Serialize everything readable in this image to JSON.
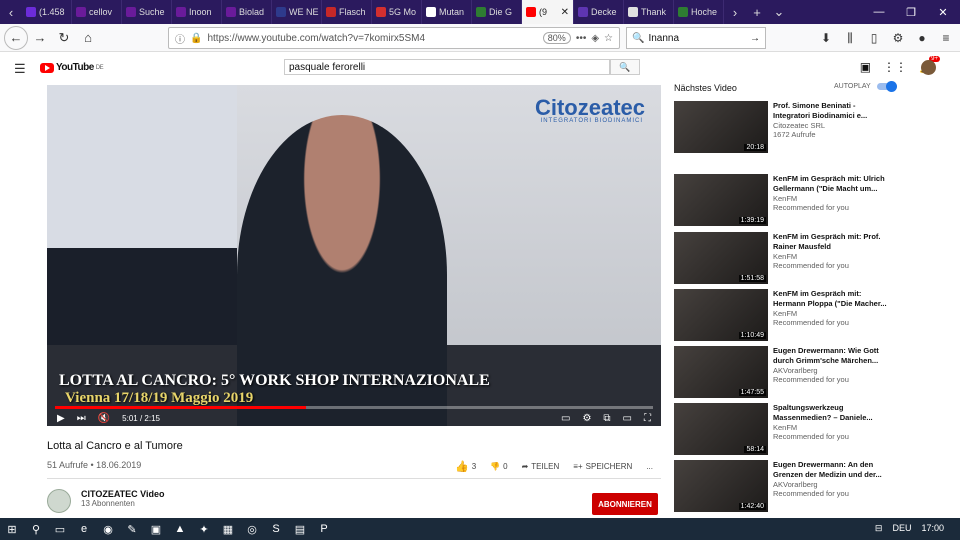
{
  "browser": {
    "tabs": [
      {
        "label": "(1.458",
        "color": "#6c2cd9"
      },
      {
        "label": "cellov",
        "color": "#6a1b9a"
      },
      {
        "label": "Suche",
        "color": "#6a1b9a"
      },
      {
        "label": "Inoon",
        "color": "#6a1b9a"
      },
      {
        "label": "Biolad",
        "color": "#6a1b9a"
      },
      {
        "label": "WE NE GE",
        "color": "#2e3a8c"
      },
      {
        "label": "Flasch",
        "color": "#c62828"
      },
      {
        "label": "5G Mo",
        "color": "#d32f2f"
      },
      {
        "label": "Mutan",
        "color": "#ffffff"
      },
      {
        "label": "Die G",
        "color": "#2e7d32"
      },
      {
        "label": "(9",
        "color": "#ff0000"
      },
      {
        "label": "Decke",
        "color": "#5e35b1"
      },
      {
        "label": "Thank",
        "color": "#e0e0e0"
      },
      {
        "label": "Hoche",
        "color": "#2e7d32"
      }
    ],
    "active_tab_index": 10,
    "url": "https://www.youtube.com/watch?v=7komirx5SM4",
    "zoom": "80%",
    "search_value": "Inanna"
  },
  "youtube": {
    "logo_text": "YouTube",
    "logo_region": "DE",
    "search_value": "pasquale ferorelli",
    "notification_count": "9+",
    "video": {
      "caption_line1": "LOTTA AL CANCRO: 5° WORK SHOP INTERNAZIONALE",
      "caption_line2": "Vienna 17/18/19 Maggio 2019",
      "brand": "Citozeatec",
      "brand_sub": "INTEGRATORI BIODINAMICI",
      "time": "5:01 / 2:15",
      "progress_fraction": 0.42,
      "title": "Lotta al Cancro e al Tumore",
      "meta": "51 Aufrufe • 18.06.2019",
      "likes": "3",
      "dislikes": "0",
      "share_label": "TEILEN",
      "save_label": "SPEICHERN",
      "more_label": "..."
    },
    "channel": {
      "name": "CITOZEATEC Video",
      "subs": "13 Abonnenten",
      "subscribe_label": "ABONNIEREN"
    },
    "sidebar": {
      "up_next_label": "Nächstes Video",
      "autoplay_label": "AUTOPLAY",
      "items": [
        {
          "title": "Prof. Simone Beninati - Integratori Biodinamici e...",
          "channel": "Citozeatec SRL",
          "views": "1672 Aufrufe",
          "duration": "20:18"
        },
        {
          "title": "KenFM im Gespräch mit: Ulrich Gellermann (\"Die Macht um...",
          "channel": "KenFM",
          "views": "Recommended for you",
          "duration": "1:39:19"
        },
        {
          "title": "KenFM im Gespräch mit: Prof. Rainer Mausfeld",
          "channel": "KenFM",
          "views": "Recommended for you",
          "duration": "1:51:58"
        },
        {
          "title": "KenFM im Gespräch mit: Hermann Ploppa (\"Die Macher...",
          "channel": "KenFM",
          "views": "Recommended for you",
          "duration": "1:10:49"
        },
        {
          "title": "Eugen Drewermann: Wie Gott durch Grimm'sche Märchen...",
          "channel": "AKVorarlberg",
          "views": "Recommended for you",
          "duration": "1:47:55"
        },
        {
          "title": "Spaltungswerkzeug Massenmedien? – Daniele...",
          "channel": "KenFM",
          "views": "Recommended for you",
          "duration": "58:14"
        },
        {
          "title": "Eugen Drewermann: An den Grenzen der Medizin und der...",
          "channel": "AKVorarlberg",
          "views": "Recommended for you",
          "duration": "1:42:40"
        }
      ]
    }
  },
  "taskbar": {
    "lang": "DEU",
    "time": "17:00"
  }
}
